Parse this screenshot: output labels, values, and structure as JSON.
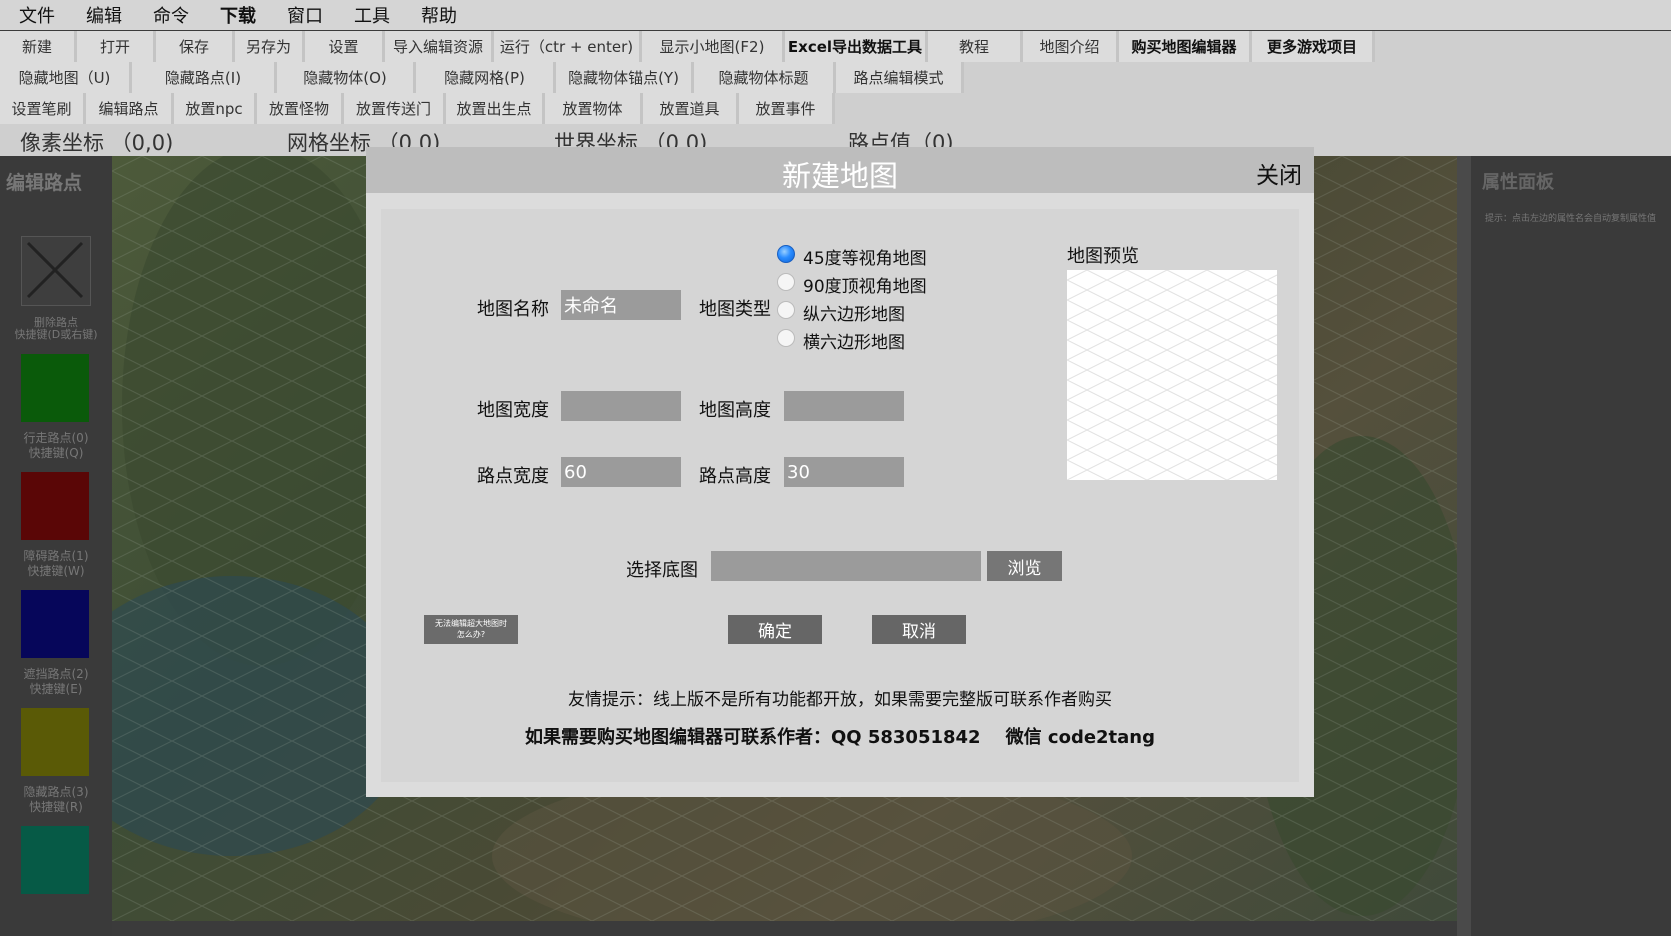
{
  "menu": [
    "文件",
    "编辑",
    "命令",
    "下载",
    "窗口",
    "工具",
    "帮助"
  ],
  "toolbar1": [
    "新建",
    "打开",
    "保存",
    "另存为",
    "设置",
    "导入编辑资源",
    "运行（ctr + enter)",
    "显示小地图(F2)",
    "Excel导出数据工具",
    "教程",
    "地图介绍",
    "购买地图编辑器",
    "更多游戏项目"
  ],
  "toolbar2": [
    "隐藏地图（U)",
    "隐藏路点(I)",
    "隐藏物体(O)",
    "隐藏网格(P)",
    "隐藏物体锚点(Y)",
    "隐藏物体标题",
    "路点编辑模式"
  ],
  "toolbar3": [
    "设置笔刷",
    "编辑路点",
    "放置npc",
    "放置怪物",
    "放置传送门",
    "放置出生点",
    "放置物体",
    "放置道具",
    "放置事件"
  ],
  "coords": {
    "pixel": "像素坐标 （0,0)",
    "grid": "网格坐标 （0,0)",
    "world": "世界坐标 （0,0)",
    "waypoint": "路点值（0)"
  },
  "left_panel": {
    "title": "编辑路点",
    "items": [
      {
        "label1": "删除路点",
        "label2": "快捷键(D或右键)",
        "color": "#3a3a3a"
      },
      {
        "label1": "行走路点(0)",
        "label2": "快捷键(Q)",
        "color": "#0a7a0a"
      },
      {
        "label1": "障碍路点(1)",
        "label2": "快捷键(W)",
        "color": "#7a0a0a"
      },
      {
        "label1": "遮挡路点(2)",
        "label2": "快捷键(E)",
        "color": "#0a0a7a"
      },
      {
        "label1": "隐藏路点(3)",
        "label2": "快捷键(R)",
        "color": "#7a7a0a"
      },
      {
        "label1": "",
        "label2": "",
        "color": "#0a7a5a"
      }
    ]
  },
  "right_panel": {
    "title": "属性面板",
    "hint": "提示：点击左边的属性名会自动复制属性值"
  },
  "dialog": {
    "title": "新建地图",
    "close": "关闭",
    "map_name_label": "地图名称",
    "map_name_value": "未命名",
    "map_type_label": "地图类型",
    "map_types": [
      "45度等视角地图",
      "90度顶视角地图",
      "纵六边形地图",
      "横六边形地图"
    ],
    "selected_type_index": 0,
    "preview_label": "地图预览",
    "width_label": "地图宽度",
    "width_value": "",
    "height_label": "地图高度",
    "height_value": "",
    "tile_width_label": "路点宽度",
    "tile_width_value": "60",
    "tile_height_label": "路点高度",
    "tile_height_value": "30",
    "bg_label": "选择底图",
    "bg_value": "",
    "browse": "浏览",
    "help_button_line1": "无法编辑超大地图时",
    "help_button_line2": "怎么办?",
    "ok": "确定",
    "cancel": "取消",
    "tip": "友情提示：线上版不是所有功能都开放，如果需要完整版可联系作者购买",
    "contact": "如果需要购买地图编辑器可联系作者：QQ 583051842    微信 code2tang"
  }
}
